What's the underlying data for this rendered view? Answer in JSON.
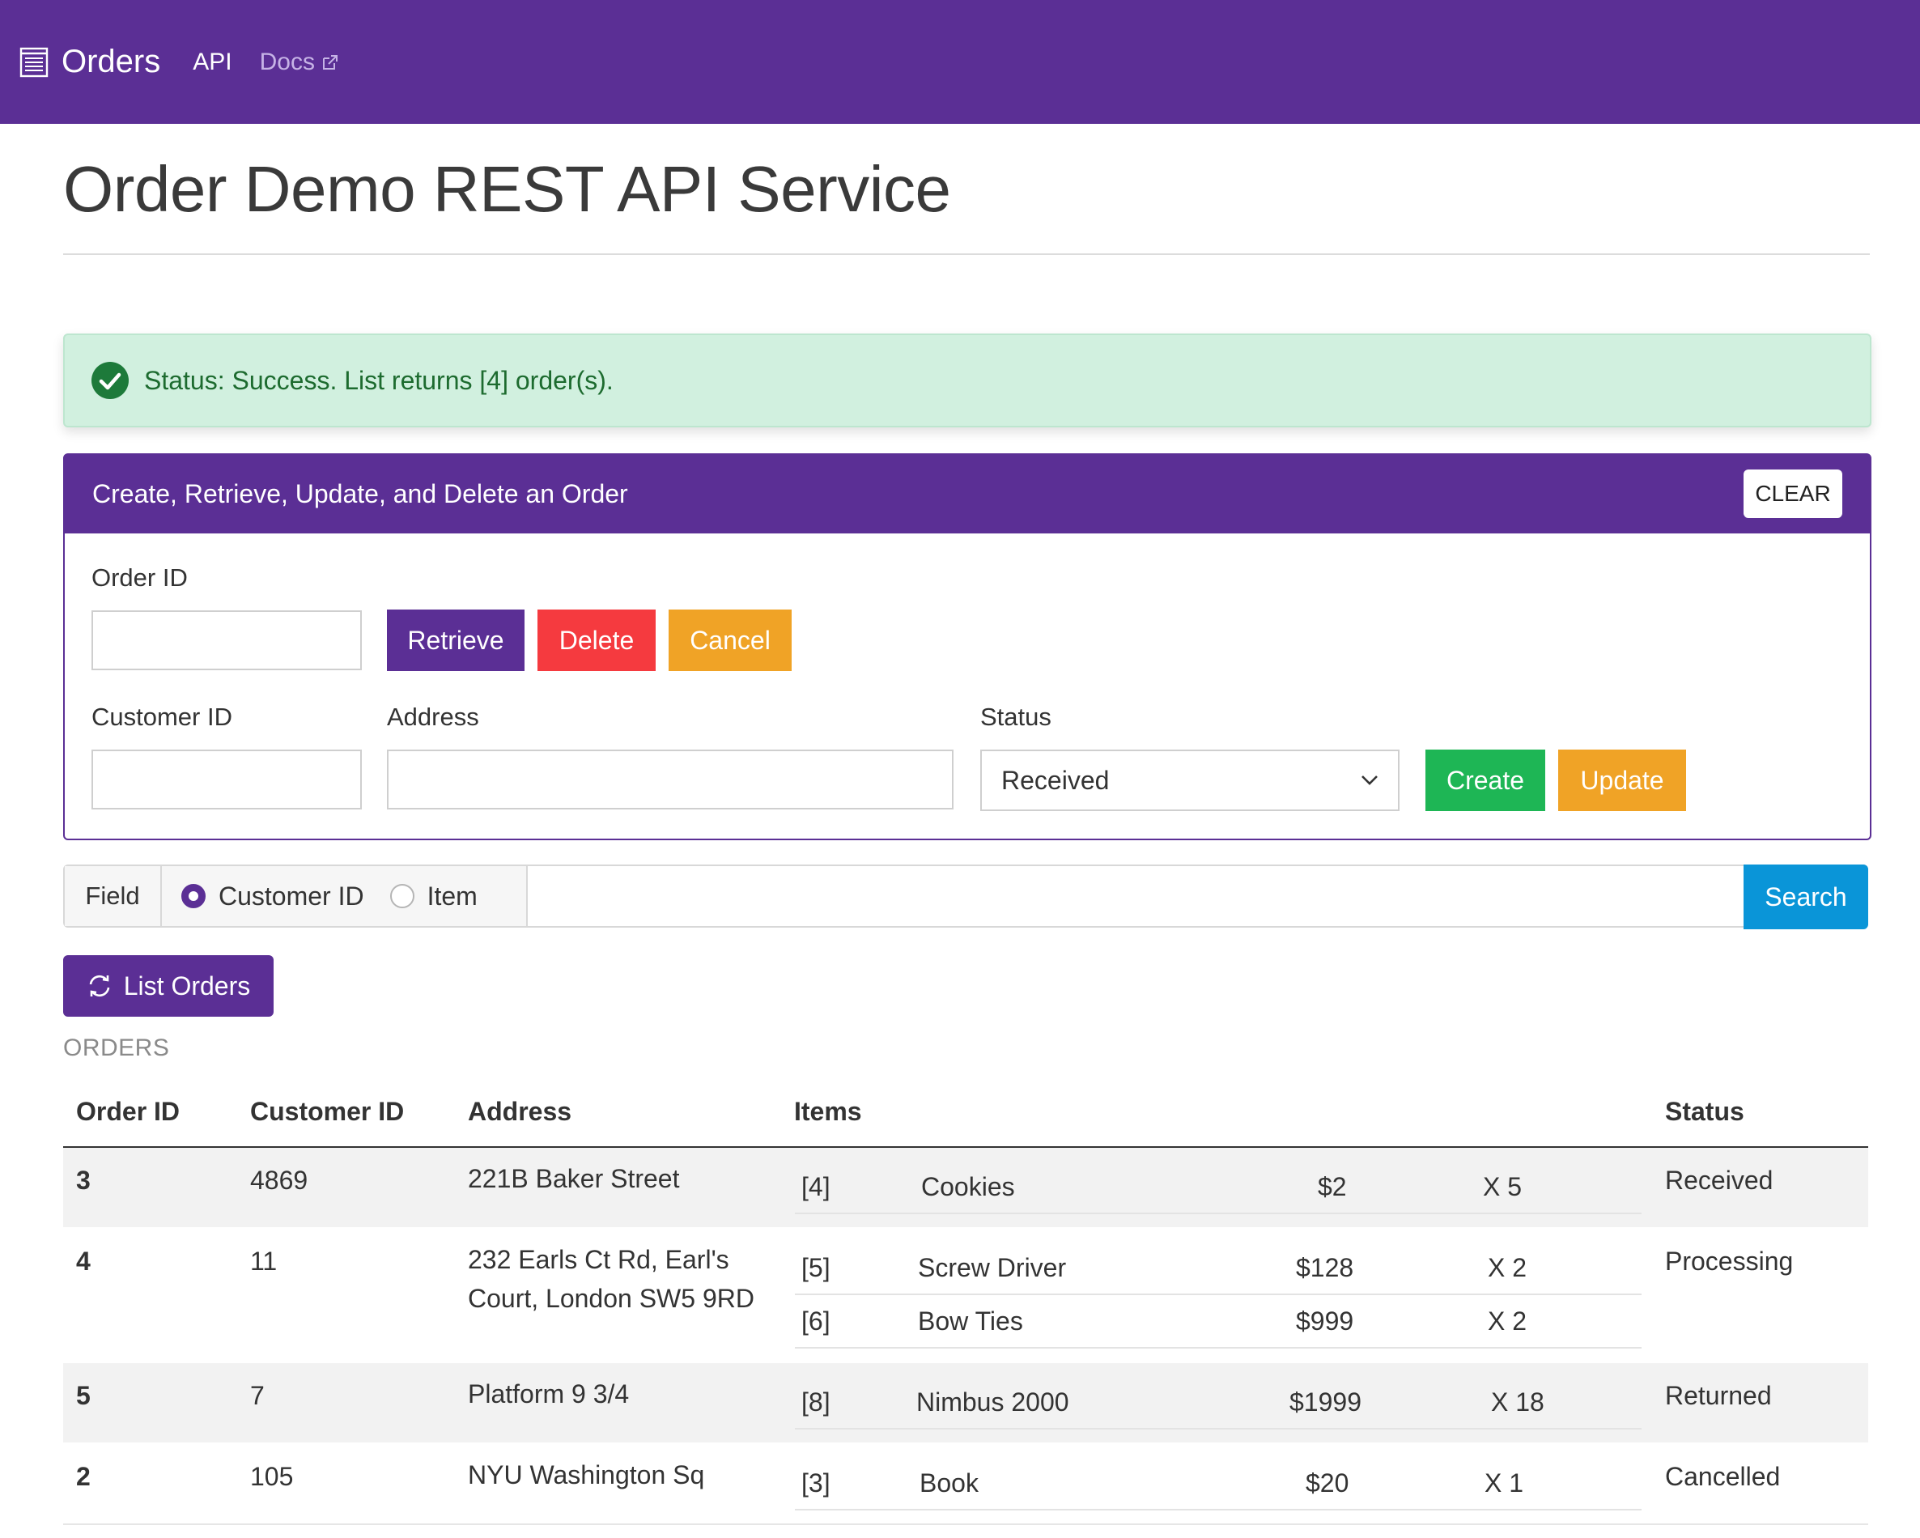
{
  "nav": {
    "brand": "Orders",
    "links": [
      "API",
      "Docs"
    ],
    "icons": {
      "brand": "list-icon",
      "docs": "external-link-icon"
    }
  },
  "page": {
    "title": "Order Demo REST API Service"
  },
  "alert": {
    "message": "Status: Success. List returns [4] order(s).",
    "icon": "check-circle-icon"
  },
  "crud": {
    "title": "Create, Retrieve, Update, and Delete an Order",
    "clear_label": "CLEAR",
    "order_id_label": "Order ID",
    "order_id_value": "",
    "retrieve_label": "Retrieve",
    "delete_label": "Delete",
    "cancel_label": "Cancel",
    "customer_id_label": "Customer ID",
    "customer_id_value": "",
    "address_label": "Address",
    "address_value": "",
    "status_label": "Status",
    "status_value": "Received",
    "create_label": "Create",
    "update_label": "Update"
  },
  "search": {
    "field_label": "Field",
    "options": [
      "Customer ID",
      "Item"
    ],
    "selected": "Customer ID",
    "query": "",
    "button_label": "Search"
  },
  "list_button": "List Orders",
  "orders_label": "ORDERS",
  "table": {
    "headers": [
      "Order ID",
      "Customer ID",
      "Address",
      "Items",
      "Status"
    ],
    "rows": [
      {
        "order_id": "3",
        "customer_id": "4869",
        "address": "221B Baker Street",
        "status": "Received",
        "items": [
          {
            "id": "[4]",
            "name": "Cookies",
            "price": "$2",
            "qty": "X 5"
          }
        ]
      },
      {
        "order_id": "4",
        "customer_id": "11",
        "address": "232 Earls Ct Rd, Earl's Court, London SW5 9RD",
        "status": "Processing",
        "items": [
          {
            "id": "[5]",
            "name": "Screw Driver",
            "price": "$128",
            "qty": "X 2"
          },
          {
            "id": "[6]",
            "name": "Bow Ties",
            "price": "$999",
            "qty": "X 2"
          }
        ]
      },
      {
        "order_id": "5",
        "customer_id": "7",
        "address": "Platform 9 3/4",
        "status": "Returned",
        "items": [
          {
            "id": "[8]",
            "name": "Nimbus 2000",
            "price": "$1999",
            "qty": "X 18"
          }
        ]
      },
      {
        "order_id": "2",
        "customer_id": "105",
        "address": "NYU Washington Sq",
        "status": "Cancelled",
        "items": [
          {
            "id": "[3]",
            "name": "Book",
            "price": "$20",
            "qty": "X 1"
          }
        ]
      }
    ]
  },
  "colors": {
    "primary": "#5b2f95",
    "danger": "#f53a3f",
    "warning": "#f0a326",
    "success": "#1eb655",
    "info": "#0a95d8",
    "alert_bg": "#d1f0df"
  }
}
